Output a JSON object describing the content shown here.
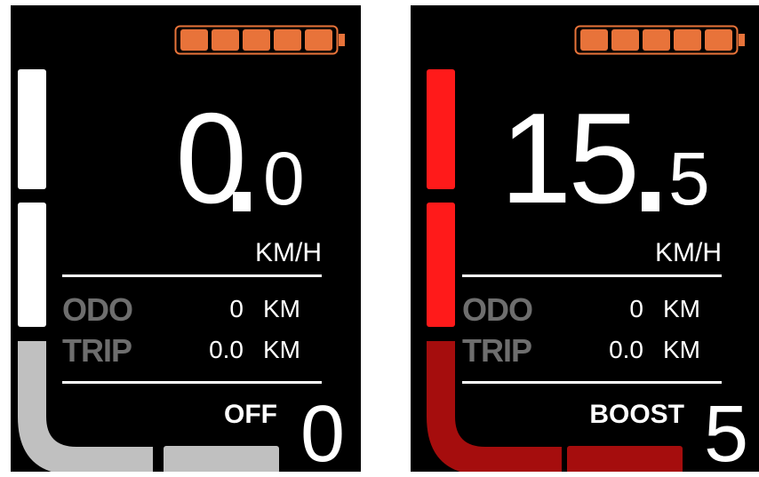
{
  "displays": [
    {
      "id": "left",
      "battery_color": "#e8733a",
      "battery_bars": 5,
      "speed_integer": "0",
      "speed_decimal": "0",
      "speed_unit": "KM/H",
      "odo_label": "ODO",
      "odo_value": "0",
      "odo_unit": "KM",
      "trip_label": "TRIP",
      "trip_value": "0.0",
      "trip_unit": "KM",
      "mode_label": "OFF",
      "assist_level": "0",
      "assist_bar_colors": {
        "top": "#ffffff",
        "middle": "#ffffff",
        "corner": "#c0c0c0"
      }
    },
    {
      "id": "right",
      "battery_color": "#e8733a",
      "battery_bars": 5,
      "speed_integer": "15",
      "speed_decimal": "5",
      "speed_unit": "KM/H",
      "odo_label": "ODO",
      "odo_value": "0",
      "odo_unit": "KM",
      "trip_label": "TRIP",
      "trip_value": "0.0",
      "trip_unit": "KM",
      "mode_label": "BOOST",
      "assist_level": "5",
      "assist_bar_colors": {
        "top": "#ff1a1a",
        "middle": "#ff1a1a",
        "corner": "#a50d0d"
      }
    }
  ]
}
